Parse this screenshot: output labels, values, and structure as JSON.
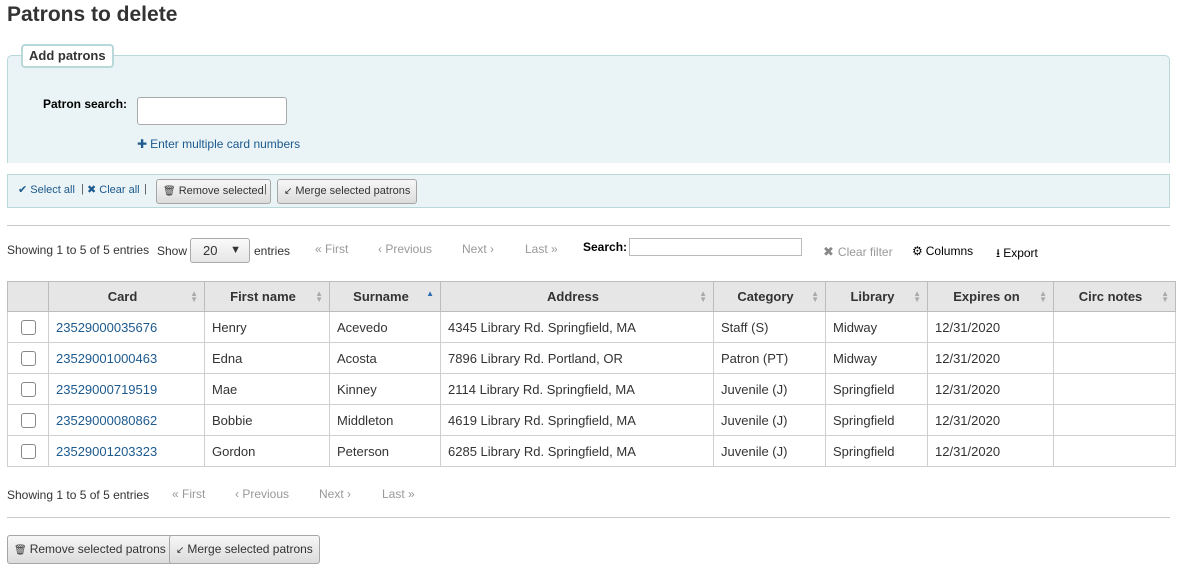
{
  "page": {
    "title": "Patrons to delete"
  },
  "add_patrons": {
    "legend": "Add patrons",
    "search_label": "Patron search:",
    "search_value": "",
    "multi_link": "Enter multiple card numbers"
  },
  "toolbar": {
    "select_all": "Select all",
    "clear_all": "Clear all",
    "separator": "|",
    "remove_selected": "Remove selected",
    "merge_selected": "Merge selected patrons"
  },
  "table_controls": {
    "info": "Showing 1 to 5 of 5 entries",
    "show_label": "Show",
    "page_length": "20",
    "entries_label": "entries",
    "search_label": "Search:",
    "search_value": "",
    "clear_filter": "Clear filter",
    "columns": "Columns",
    "export": "Export"
  },
  "pagination": {
    "first": "First",
    "previous": "Previous",
    "next": "Next",
    "last": "Last"
  },
  "columns": [
    "Card",
    "First name",
    "Surname",
    "Address",
    "Category",
    "Library",
    "Expires on",
    "Circ notes"
  ],
  "sorted_column": "Surname",
  "rows": [
    {
      "card": "23529000035676",
      "first": "Henry",
      "surname": "Acevedo",
      "address": "4345 Library Rd. Springfield, MA",
      "category": "Staff (S)",
      "library": "Midway",
      "expires": "12/31/2020",
      "notes": ""
    },
    {
      "card": "23529001000463",
      "first": "Edna",
      "surname": "Acosta",
      "address": "7896 Library Rd. Portland, OR",
      "category": "Patron (PT)",
      "library": "Midway",
      "expires": "12/31/2020",
      "notes": ""
    },
    {
      "card": "23529000719519",
      "first": "Mae",
      "surname": "Kinney",
      "address": "2114 Library Rd. Springfield, MA",
      "category": "Juvenile (J)",
      "library": "Springfield",
      "expires": "12/31/2020",
      "notes": ""
    },
    {
      "card": "23529000080862",
      "first": "Bobbie",
      "surname": "Middleton",
      "address": "4619 Library Rd. Springfield, MA",
      "category": "Juvenile (J)",
      "library": "Springfield",
      "expires": "12/31/2020",
      "notes": ""
    },
    {
      "card": "23529001203323",
      "first": "Gordon",
      "surname": "Peterson",
      "address": "6285 Library Rd. Springfield, MA",
      "category": "Juvenile (J)",
      "library": "Springfield",
      "expires": "12/31/2020",
      "notes": ""
    }
  ],
  "footer": {
    "info": "Showing 1 to 5 of 5 entries",
    "remove_selected_patrons": "Remove selected patrons",
    "merge_selected_patrons": "Merge selected patrons"
  },
  "colors": {
    "link": "#1d5a8e",
    "panel_bg": "#eaf3f5",
    "panel_border": "#b9d8d9"
  }
}
